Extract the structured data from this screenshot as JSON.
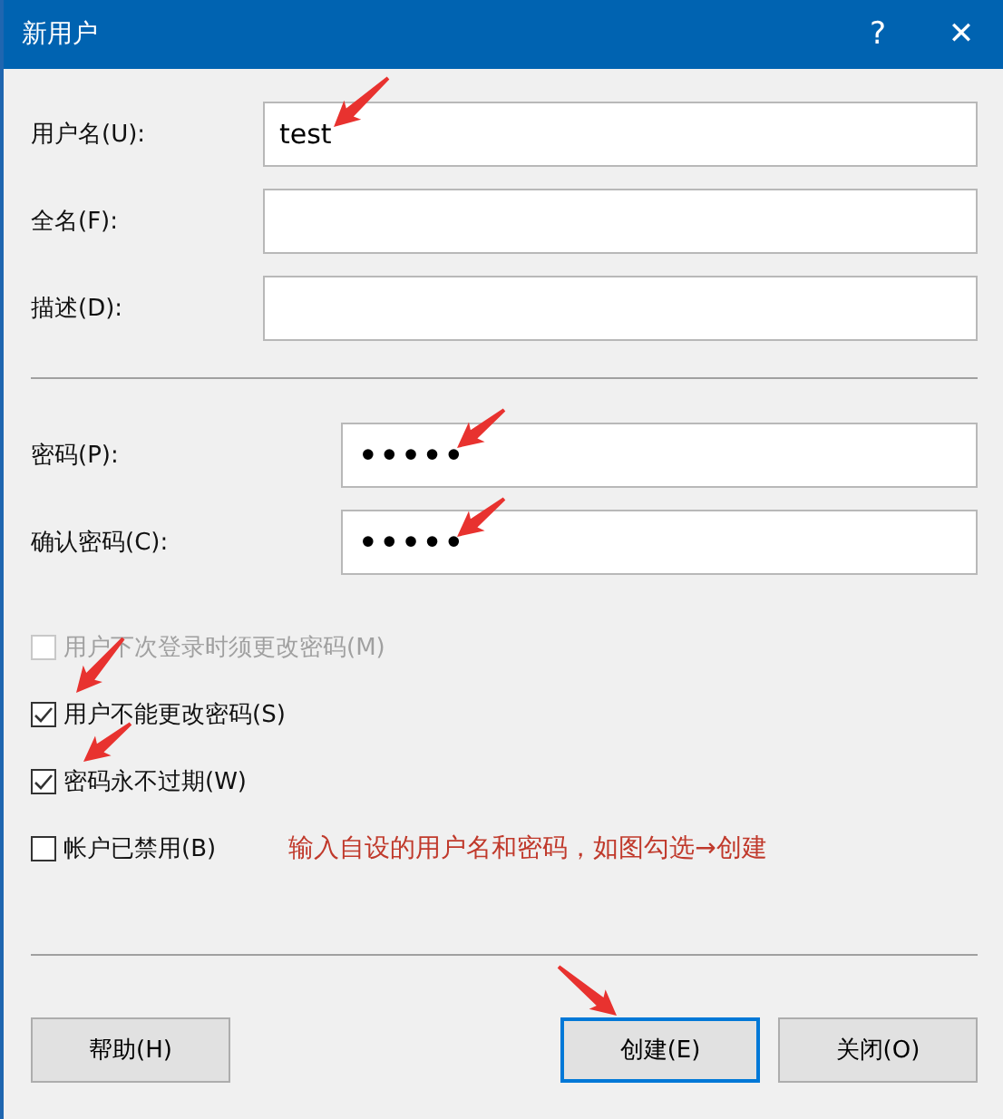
{
  "window": {
    "title": "新用户",
    "help_glyph": "?",
    "close_glyph": "✕"
  },
  "fields": [
    {
      "label": "用户名(U):",
      "value": "test"
    },
    {
      "label": "全名(F):"
    },
    {
      "label": "描述(D):"
    }
  ],
  "password_fields": [
    {
      "label": "密码(P):",
      "value": "•••••"
    },
    {
      "label": "确认密码(C):",
      "value": "•••••"
    }
  ],
  "options": [
    {
      "label": "用户下次登录时须更改密码(M)",
      "checked": false,
      "disabled": true
    },
    {
      "label": "用户不能更改密码(S)",
      "checked": true,
      "disabled": false
    },
    {
      "label": "密码永不过期(W)",
      "checked": true,
      "disabled": false
    },
    {
      "label": "帐户已禁用(B)",
      "checked": false,
      "disabled": false
    }
  ],
  "annotation": "输入自设的用户名和密码，如图勾选→创建",
  "buttons": [
    {
      "label": "帮助(H)",
      "selected": false
    },
    {
      "label": "创建(E)",
      "selected": true
    },
    {
      "label": "关闭(O)",
      "selected": false
    }
  ]
}
